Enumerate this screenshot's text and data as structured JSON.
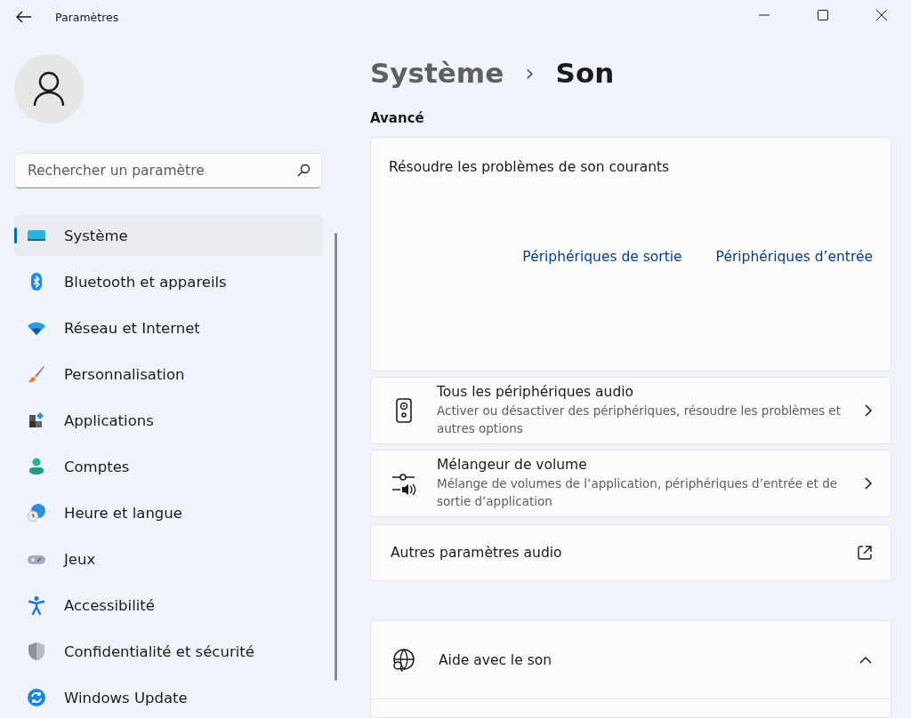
{
  "window": {
    "title": "Paramètres"
  },
  "search": {
    "placeholder": "Rechercher un paramètre"
  },
  "nav": [
    {
      "label": "Système",
      "selected": true
    },
    {
      "label": "Bluetooth et appareils",
      "selected": false
    },
    {
      "label": "Réseau et Internet",
      "selected": false
    },
    {
      "label": "Personnalisation",
      "selected": false
    },
    {
      "label": "Applications",
      "selected": false
    },
    {
      "label": "Comptes",
      "selected": false
    },
    {
      "label": "Heure et langue",
      "selected": false
    },
    {
      "label": "Jeux",
      "selected": false
    },
    {
      "label": "Accessibilité",
      "selected": false
    },
    {
      "label": "Confidentialité et sécurité",
      "selected": false
    },
    {
      "label": "Windows Update",
      "selected": false
    }
  ],
  "breadcrumb": {
    "parent": "Système",
    "separator": "›",
    "current": "Son"
  },
  "section": "Avancé",
  "troubleshoot": {
    "title": "Résoudre les problèmes de son courants",
    "links": [
      "Périphériques de sortie",
      "Périphériques d’entrée"
    ]
  },
  "cards": [
    {
      "kind": "nav",
      "title": "Tous les périphériques audio",
      "description": "Activer ou désactiver des périphériques, résoudre les problèmes et autres options"
    },
    {
      "kind": "nav",
      "title": "Mélangeur de volume",
      "description": "Mélange de volumes de l’application, périphériques d’entrée et de sortie d’application"
    },
    {
      "kind": "external",
      "title": "Autres paramètres audio"
    }
  ],
  "help": {
    "title": "Aide avec le son",
    "expanded": true
  }
}
